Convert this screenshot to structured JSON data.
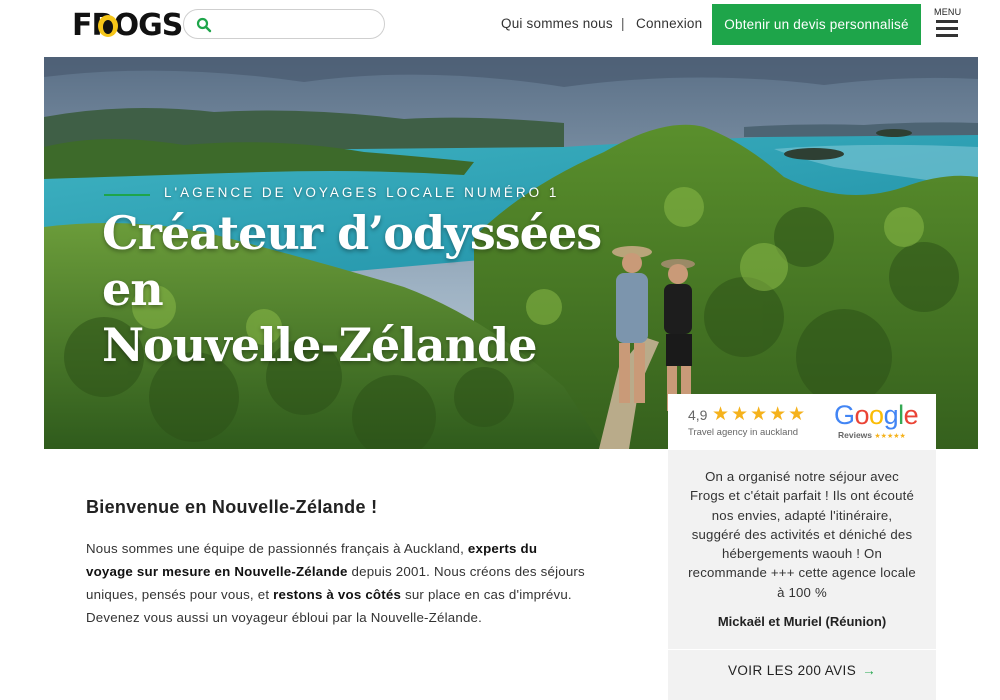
{
  "header": {
    "logo_text": "FROGS",
    "search": {
      "placeholder": "",
      "value": ""
    },
    "nav": {
      "about": "Qui sommes nous",
      "separator": "|",
      "login": "Connexion"
    },
    "cta_label": "Obtenir un devis personnalisé",
    "menu_label": "MENU"
  },
  "hero": {
    "eyebrow": "L'AGENCE DE VOYAGES LOCALE NUMÉRO 1",
    "title_line1": "Créateur d’odyssées en",
    "title_line2": "Nouvelle-Zélande"
  },
  "review": {
    "score": "4,9",
    "stars": "★★★★★",
    "subtitle": "Travel agency in auckland",
    "google_word": "Google",
    "google_sub": "Reviews",
    "google_sub_stars": "★★★★★",
    "quote": "On a organisé notre séjour avec Frogs et c'était parfait ! Ils ont écouté nos envies, adapté l'itinéraire, suggéré des activités et déniché des hébergements waouh ! On recommande +++ cette agence locale à 100 %",
    "author": "Mickaël et Muriel (Réunion)",
    "link_label": "VOIR LES 200 AVIS",
    "link_arrow": "→"
  },
  "welcome": {
    "title": "Bienvenue en Nouvelle-Zélande !",
    "p1": "Nous sommes une équipe de passionnés français à Auckland, ",
    "p1_bold": "experts du voyage sur mesure en Nouvelle-Zélande",
    "p2": " depuis 2001. Nous créons des séjours uniques, pensés pour vous, et ",
    "p2_bold": "restons à vos côtés",
    "p3": " sur place en cas d'imprévu. Devenez vous aussi un voyageur ébloui par la Nouvelle-Zélande."
  },
  "colors": {
    "accent_green": "#1ea54a",
    "star_yellow": "#f5b21c",
    "card_grey": "#f2f2f2"
  },
  "icons": {
    "search": "search-icon",
    "menu": "hamburger-icon",
    "arrow": "arrow-right-icon"
  }
}
